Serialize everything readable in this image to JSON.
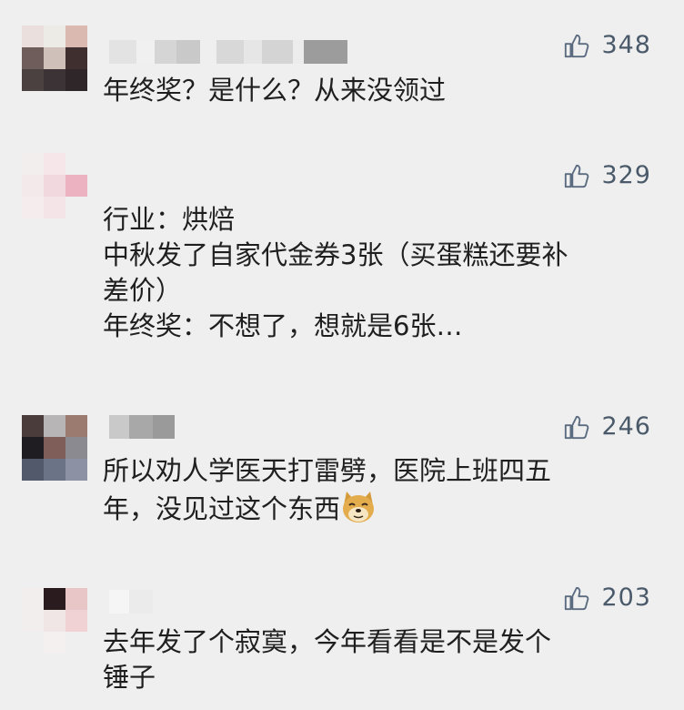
{
  "comments": [
    {
      "likes": "348",
      "lines": [
        "年终奖？是什么？从来没领过"
      ]
    },
    {
      "likes": "329",
      "lines": [
        "行业：烘焙",
        "中秋发了自家代金券3张（买蛋糕还要补",
        "差价）",
        "年终奖：不想了，想就是6张…"
      ]
    },
    {
      "likes": "246",
      "lines": [
        "所以劝人学医天打雷劈，医院上班四五",
        "年，没见过这个东西"
      ],
      "emoji": "doge-emoji"
    },
    {
      "likes": "203",
      "lines": [
        "去年发了个寂寞，今年看看是不是发个",
        "锤子"
      ]
    }
  ],
  "colors": {
    "background": "#efefef",
    "like_count": "#4a5a6a",
    "thumb": "#5b6b80"
  }
}
